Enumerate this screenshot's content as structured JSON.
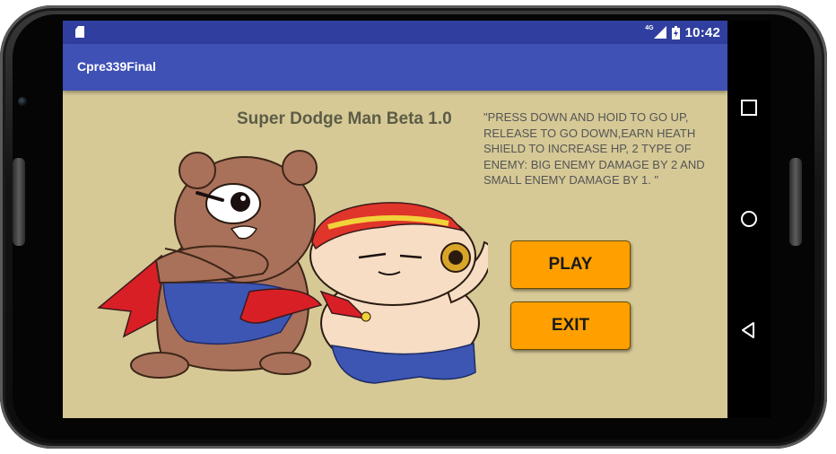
{
  "status_bar": {
    "network_label": "4G",
    "time": "10:42"
  },
  "app_bar": {
    "title": "Cpre339Final"
  },
  "main": {
    "game_title": "Super Dodge Man Beta 1.0",
    "instructions": "\"PRESS DOWN AND HOID TO GO UP, RELEASE TO GO DOWN,EARN HEATH SHIELD TO INCREASE HP, 2 TYPE OF ENEMY: BIG ENEMY DAMAGE BY 2 AND SMALL ENEMY DAMAGE BY 1. \"",
    "play_label": "PLAY",
    "exit_label": "EXIT"
  },
  "nav_bar": {
    "icons": [
      "recents-icon",
      "home-icon",
      "back-icon"
    ]
  },
  "colors": {
    "status_bar": "#303f9f",
    "app_bar": "#3f51b5",
    "screen_background": "#d6c996",
    "button": "#ffa000"
  }
}
